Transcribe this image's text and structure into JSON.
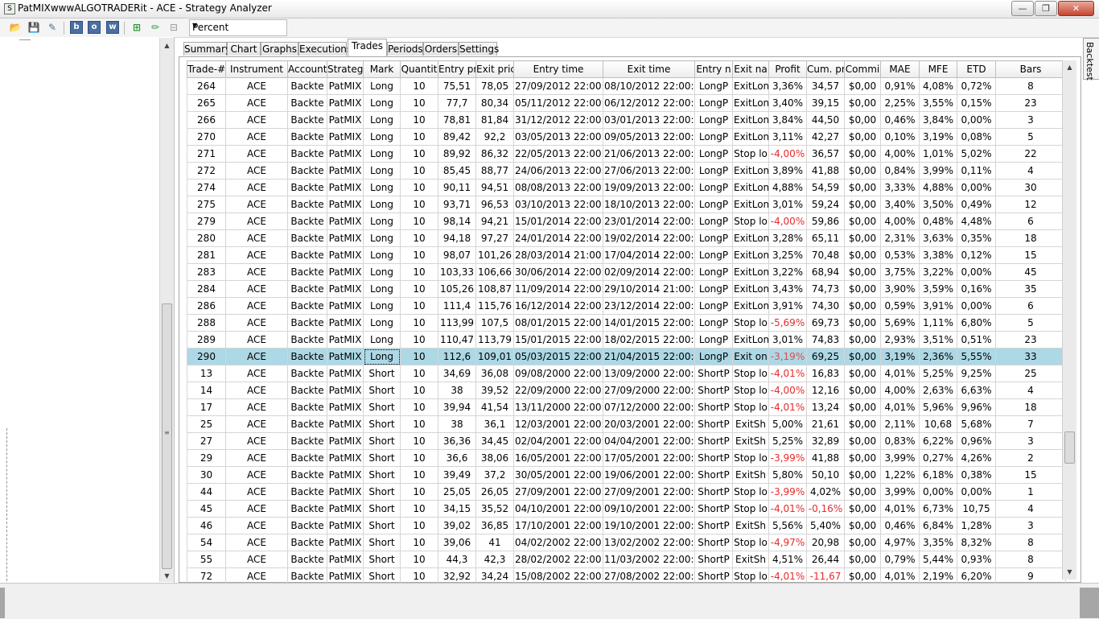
{
  "window": {
    "title": "PatMIXwwwALGOTRADERit - ACE - Strategy Analyzer"
  },
  "toolbar": {
    "b_label": "b",
    "o_label": "o",
    "w_label": "w",
    "display_mode": "Percent"
  },
  "tabs": [
    "Summary",
    "Chart",
    "Graphs",
    "Executions",
    "Trades",
    "Periods",
    "Orders",
    "Settings"
  ],
  "active_tab": "Trades",
  "side_tab": "Backtest",
  "columns": [
    "Trade-#",
    "Instrument",
    "Account",
    "Strateg",
    "Mark",
    "Quantit",
    "Entry pr",
    "Exit pric",
    "Entry time",
    "Exit time",
    "Entry n",
    "Exit na",
    "Profit",
    "Cum. pr",
    "Commi",
    "MAE",
    "MFE",
    "ETD",
    "Bars"
  ],
  "selected_row": 16,
  "rows": [
    [
      "264",
      "ACE",
      "Backte",
      "PatMIX",
      "Long",
      "10",
      "75,51",
      "78,05",
      "27/09/2012 22:00:00",
      "08/10/2012 22:00:00",
      "LongP",
      "ExitLon",
      "3,36%",
      "34,57",
      "$0,00",
      "0,91%",
      "4,08%",
      "0,72%",
      "8"
    ],
    [
      "265",
      "ACE",
      "Backte",
      "PatMIX",
      "Long",
      "10",
      "77,7",
      "80,34",
      "05/11/2012 22:00:00",
      "06/12/2012 22:00:00",
      "LongP",
      "ExitLon",
      "3,40%",
      "39,15",
      "$0,00",
      "2,25%",
      "3,55%",
      "0,15%",
      "23"
    ],
    [
      "266",
      "ACE",
      "Backte",
      "PatMIX",
      "Long",
      "10",
      "78,81",
      "81,84",
      "31/12/2012 22:00:00",
      "03/01/2013 22:00:00",
      "LongP",
      "ExitLon",
      "3,84%",
      "44,50",
      "$0,00",
      "0,46%",
      "3,84%",
      "0,00%",
      "3"
    ],
    [
      "270",
      "ACE",
      "Backte",
      "PatMIX",
      "Long",
      "10",
      "89,42",
      "92,2",
      "03/05/2013 22:00:00",
      "09/05/2013 22:00:00",
      "LongP",
      "ExitLon",
      "3,11%",
      "42,27",
      "$0,00",
      "0,10%",
      "3,19%",
      "0,08%",
      "5"
    ],
    [
      "271",
      "ACE",
      "Backte",
      "PatMIX",
      "Long",
      "10",
      "89,92",
      "86,32",
      "22/05/2013 22:00:00",
      "21/06/2013 22:00:00",
      "LongP",
      "Stop lo",
      "-4,00%",
      "36,57",
      "$0,00",
      "4,00%",
      "1,01%",
      "5,02%",
      "22"
    ],
    [
      "272",
      "ACE",
      "Backte",
      "PatMIX",
      "Long",
      "10",
      "85,45",
      "88,77",
      "24/06/2013 22:00:00",
      "27/06/2013 22:00:00",
      "LongP",
      "ExitLon",
      "3,89%",
      "41,88",
      "$0,00",
      "0,84%",
      "3,99%",
      "0,11%",
      "4"
    ],
    [
      "274",
      "ACE",
      "Backte",
      "PatMIX",
      "Long",
      "10",
      "90,11",
      "94,51",
      "08/08/2013 22:00:00",
      "19/09/2013 22:00:00",
      "LongP",
      "ExitLon",
      "4,88%",
      "54,59",
      "$0,00",
      "3,33%",
      "4,88%",
      "0,00%",
      "30"
    ],
    [
      "275",
      "ACE",
      "Backte",
      "PatMIX",
      "Long",
      "10",
      "93,71",
      "96,53",
      "03/10/2013 22:00:00",
      "18/10/2013 22:00:00",
      "LongP",
      "ExitLon",
      "3,01%",
      "59,24",
      "$0,00",
      "3,40%",
      "3,50%",
      "0,49%",
      "12"
    ],
    [
      "279",
      "ACE",
      "Backte",
      "PatMIX",
      "Long",
      "10",
      "98,14",
      "94,21",
      "15/01/2014 22:00:00",
      "23/01/2014 22:00:00",
      "LongP",
      "Stop lo",
      "-4,00%",
      "59,86",
      "$0,00",
      "4,00%",
      "0,48%",
      "4,48%",
      "6"
    ],
    [
      "280",
      "ACE",
      "Backte",
      "PatMIX",
      "Long",
      "10",
      "94,18",
      "97,27",
      "24/01/2014 22:00:00",
      "19/02/2014 22:00:00",
      "LongP",
      "ExitLon",
      "3,28%",
      "65,11",
      "$0,00",
      "2,31%",
      "3,63%",
      "0,35%",
      "18"
    ],
    [
      "281",
      "ACE",
      "Backte",
      "PatMIX",
      "Long",
      "10",
      "98,07",
      "101,26",
      "28/03/2014 21:00:00",
      "17/04/2014 22:00:00",
      "LongP",
      "ExitLon",
      "3,25%",
      "70,48",
      "$0,00",
      "0,53%",
      "3,38%",
      "0,12%",
      "15"
    ],
    [
      "283",
      "ACE",
      "Backte",
      "PatMIX",
      "Long",
      "10",
      "103,33",
      "106,66",
      "30/06/2014 22:00:00",
      "02/09/2014 22:00:00",
      "LongP",
      "ExitLon",
      "3,22%",
      "68,94",
      "$0,00",
      "3,75%",
      "3,22%",
      "0,00%",
      "45"
    ],
    [
      "284",
      "ACE",
      "Backte",
      "PatMIX",
      "Long",
      "10",
      "105,26",
      "108,87",
      "11/09/2014 22:00:00",
      "29/10/2014 21:00:00",
      "LongP",
      "ExitLon",
      "3,43%",
      "74,73",
      "$0,00",
      "3,90%",
      "3,59%",
      "0,16%",
      "35"
    ],
    [
      "286",
      "ACE",
      "Backte",
      "PatMIX",
      "Long",
      "10",
      "111,4",
      "115,76",
      "16/12/2014 22:00:00",
      "23/12/2014 22:00:00",
      "LongP",
      "ExitLon",
      "3,91%",
      "74,30",
      "$0,00",
      "0,59%",
      "3,91%",
      "0,00%",
      "6"
    ],
    [
      "288",
      "ACE",
      "Backte",
      "PatMIX",
      "Long",
      "10",
      "113,99",
      "107,5",
      "08/01/2015 22:00:00",
      "14/01/2015 22:00:00",
      "LongP",
      "Stop lo",
      "-5,69%",
      "69,73",
      "$0,00",
      "5,69%",
      "1,11%",
      "6,80%",
      "5"
    ],
    [
      "289",
      "ACE",
      "Backte",
      "PatMIX",
      "Long",
      "10",
      "110,47",
      "113,79",
      "15/01/2015 22:00:00",
      "18/02/2015 22:00:00",
      "LongP",
      "ExitLon",
      "3,01%",
      "74,83",
      "$0,00",
      "2,93%",
      "3,51%",
      "0,51%",
      "23"
    ],
    [
      "290",
      "ACE",
      "Backte",
      "PatMIX",
      "Long",
      "10",
      "112,6",
      "109,01",
      "05/03/2015 22:00:00",
      "21/04/2015 22:00:00",
      "LongP",
      "Exit on",
      "-3,19%",
      "69,25",
      "$0,00",
      "3,19%",
      "2,36%",
      "5,55%",
      "33"
    ],
    [
      "13",
      "ACE",
      "Backte",
      "PatMIX",
      "Short",
      "10",
      "34,69",
      "36,08",
      "09/08/2000 22:00:00",
      "13/09/2000 22:00:00",
      "ShortP",
      "Stop lo",
      "-4,01%",
      "16,83",
      "$0,00",
      "4,01%",
      "5,25%",
      "9,25%",
      "25"
    ],
    [
      "14",
      "ACE",
      "Backte",
      "PatMIX",
      "Short",
      "10",
      "38",
      "39,52",
      "22/09/2000 22:00:00",
      "27/09/2000 22:00:00",
      "ShortP",
      "Stop lo",
      "-4,00%",
      "12,16",
      "$0,00",
      "4,00%",
      "2,63%",
      "6,63%",
      "4"
    ],
    [
      "17",
      "ACE",
      "Backte",
      "PatMIX",
      "Short",
      "10",
      "39,94",
      "41,54",
      "13/11/2000 22:00:00",
      "07/12/2000 22:00:00",
      "ShortP",
      "Stop lo",
      "-4,01%",
      "13,24",
      "$0,00",
      "4,01%",
      "5,96%",
      "9,96%",
      "18"
    ],
    [
      "25",
      "ACE",
      "Backte",
      "PatMIX",
      "Short",
      "10",
      "38",
      "36,1",
      "12/03/2001 22:00:00",
      "20/03/2001 22:00:00",
      "ShortP",
      "ExitSh",
      "5,00%",
      "21,61",
      "$0,00",
      "2,11%",
      "10,68",
      "5,68%",
      "7"
    ],
    [
      "27",
      "ACE",
      "Backte",
      "PatMIX",
      "Short",
      "10",
      "36,36",
      "34,45",
      "02/04/2001 22:00:00",
      "04/04/2001 22:00:00",
      "ShortP",
      "ExitSh",
      "5,25%",
      "32,89",
      "$0,00",
      "0,83%",
      "6,22%",
      "0,96%",
      "3"
    ],
    [
      "29",
      "ACE",
      "Backte",
      "PatMIX",
      "Short",
      "10",
      "36,6",
      "38,06",
      "16/05/2001 22:00:00",
      "17/05/2001 22:00:00",
      "ShortP",
      "Stop lo",
      "-3,99%",
      "41,88",
      "$0,00",
      "3,99%",
      "0,27%",
      "4,26%",
      "2"
    ],
    [
      "30",
      "ACE",
      "Backte",
      "PatMIX",
      "Short",
      "10",
      "39,49",
      "37,2",
      "30/05/2001 22:00:00",
      "19/06/2001 22:00:00",
      "ShortP",
      "ExitSh",
      "5,80%",
      "50,10",
      "$0,00",
      "1,22%",
      "6,18%",
      "0,38%",
      "15"
    ],
    [
      "44",
      "ACE",
      "Backte",
      "PatMIX",
      "Short",
      "10",
      "25,05",
      "26,05",
      "27/09/2001 22:00:00",
      "27/09/2001 22:00:00",
      "ShortP",
      "Stop lo",
      "-3,99%",
      "4,02%",
      "$0,00",
      "3,99%",
      "0,00%",
      "0,00%",
      "1"
    ],
    [
      "45",
      "ACE",
      "Backte",
      "PatMIX",
      "Short",
      "10",
      "34,15",
      "35,52",
      "04/10/2001 22:00:00",
      "09/10/2001 22:00:00",
      "ShortP",
      "Stop lo",
      "-4,01%",
      "-0,16%",
      "$0,00",
      "4,01%",
      "6,73%",
      "10,75",
      "4"
    ],
    [
      "46",
      "ACE",
      "Backte",
      "PatMIX",
      "Short",
      "10",
      "39,02",
      "36,85",
      "17/10/2001 22:00:00",
      "19/10/2001 22:00:00",
      "ShortP",
      "ExitSh",
      "5,56%",
      "5,40%",
      "$0,00",
      "0,46%",
      "6,84%",
      "1,28%",
      "3"
    ],
    [
      "54",
      "ACE",
      "Backte",
      "PatMIX",
      "Short",
      "10",
      "39,06",
      "41",
      "04/02/2002 22:00:00",
      "13/02/2002 22:00:00",
      "ShortP",
      "Stop lo",
      "-4,97%",
      "20,98",
      "$0,00",
      "4,97%",
      "3,35%",
      "8,32%",
      "8"
    ],
    [
      "55",
      "ACE",
      "Backte",
      "PatMIX",
      "Short",
      "10",
      "44,3",
      "42,3",
      "28/02/2002 22:00:00",
      "11/03/2002 22:00:00",
      "ShortP",
      "ExitSh",
      "4,51%",
      "26,44",
      "$0,00",
      "0,79%",
      "5,44%",
      "0,93%",
      "8"
    ],
    [
      "72",
      "ACE",
      "Backte",
      "PatMIX",
      "Short",
      "10",
      "32,92",
      "34,24",
      "15/08/2002 22:00:00",
      "27/08/2002 22:00:00",
      "ShortP",
      "Stop lo",
      "-4,01%",
      "-11,67",
      "$0,00",
      "4,01%",
      "2,19%",
      "6,20%",
      "9"
    ]
  ],
  "colors": {
    "selected_row": "#add8e6",
    "negative": "#e82a2a"
  },
  "icons": [
    "open-folder-icon",
    "save-icon",
    "report-icon",
    "add-icon",
    "edit-icon",
    "remove-icon"
  ]
}
